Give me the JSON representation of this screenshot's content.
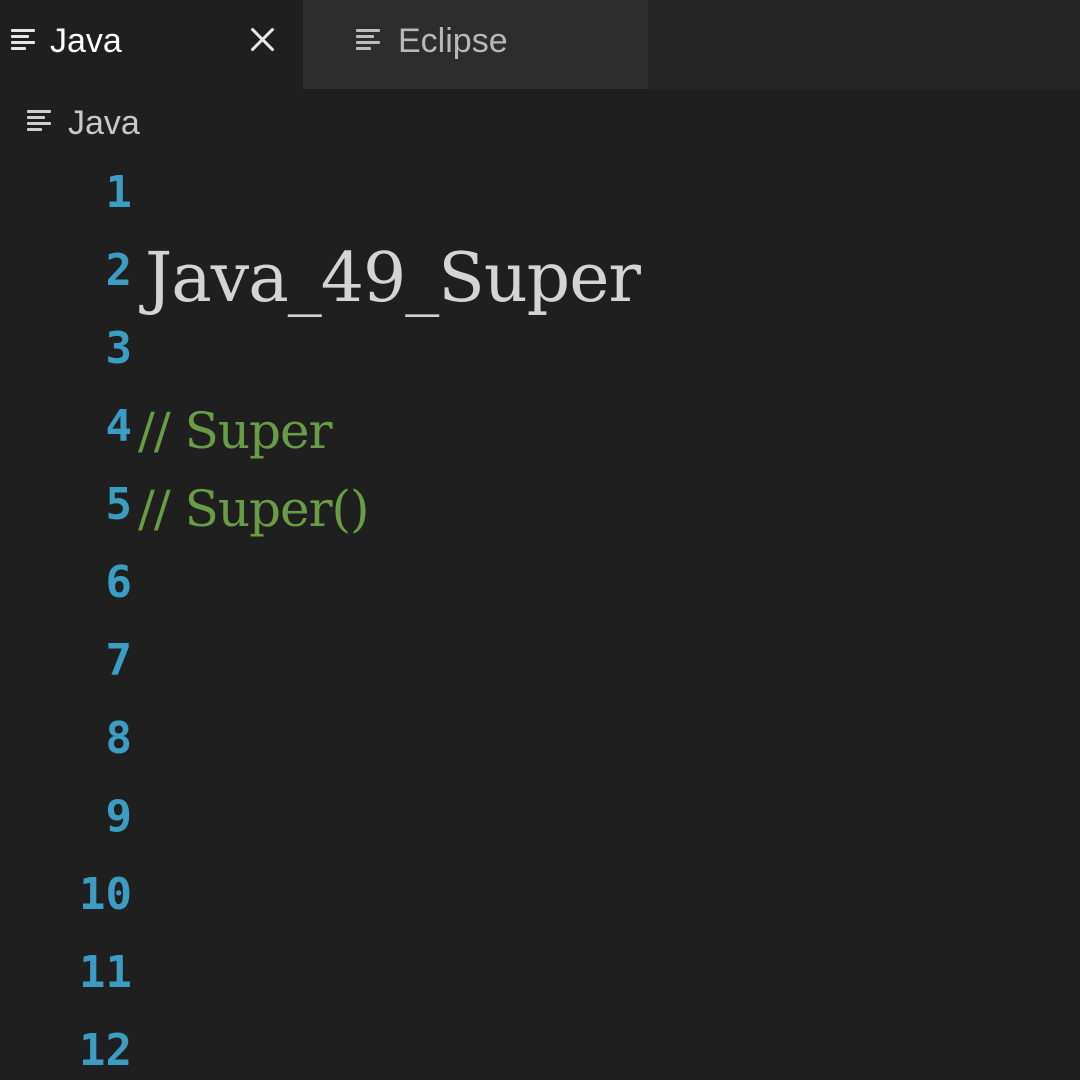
{
  "tabs": [
    {
      "label": "Java",
      "active": true,
      "icon": "lines-icon",
      "close_icon": "close-icon"
    },
    {
      "label": "Eclipse",
      "active": false,
      "icon": "lines-icon"
    }
  ],
  "breadcrumb": {
    "label": "Java",
    "icon": "lines-icon"
  },
  "editor": {
    "lines": [
      {
        "number": "1",
        "text": "",
        "kind": "plain"
      },
      {
        "number": "2",
        "text": "Java_49_Super",
        "kind": "heading"
      },
      {
        "number": "3",
        "text": "",
        "kind": "plain"
      },
      {
        "number": "4",
        "text": "// Super",
        "kind": "comment"
      },
      {
        "number": "5",
        "text": "// Super()",
        "kind": "comment"
      },
      {
        "number": "6",
        "text": "",
        "kind": "plain"
      },
      {
        "number": "7",
        "text": "",
        "kind": "plain"
      },
      {
        "number": "8",
        "text": "",
        "kind": "plain"
      },
      {
        "number": "9",
        "text": "",
        "kind": "plain"
      },
      {
        "number": "10",
        "text": "",
        "kind": "plain"
      },
      {
        "number": "11",
        "text": "",
        "kind": "plain"
      },
      {
        "number": "12",
        "text": "",
        "kind": "plain"
      }
    ]
  },
  "colors": {
    "background": "#1f1f1f",
    "tabbar": "#252526",
    "inactive_tab": "#2d2d2d",
    "line_number": "#3b9cc4",
    "comment": "#6a9b45",
    "text": "#d4d4d4"
  }
}
